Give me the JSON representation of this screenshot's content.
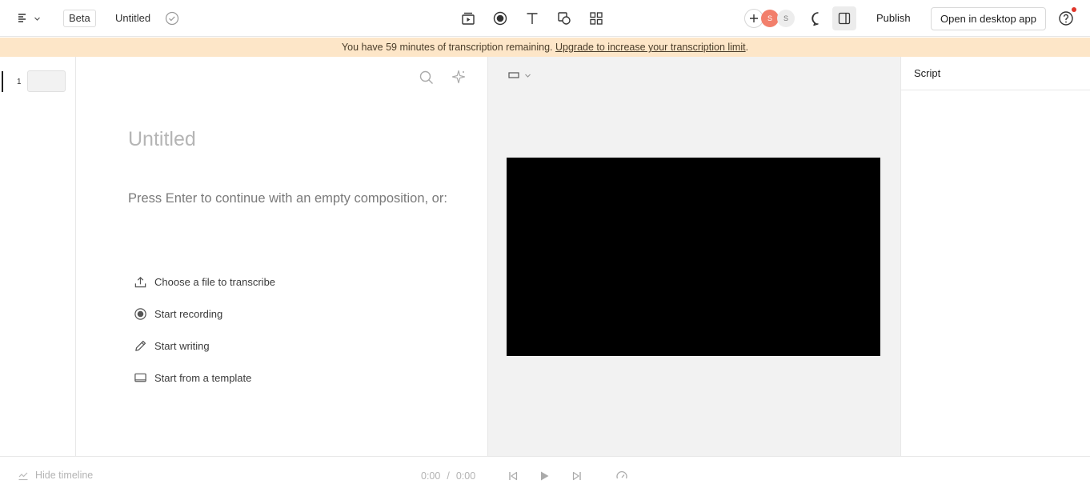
{
  "header": {
    "beta_label": "Beta",
    "document_title": "Untitled",
    "avatars": [
      "S",
      "S"
    ],
    "publish_label": "Publish",
    "desktop_button_label": "Open in desktop app"
  },
  "banner": {
    "text": "You have 59 minutes of transcription remaining. ",
    "link_text": "Upgrade to increase your transcription limit",
    "suffix": "."
  },
  "scenes": [
    {
      "number": "1"
    }
  ],
  "editor": {
    "title_placeholder": "Untitled",
    "prompt": "Press Enter to continue with an empty composition, or:",
    "options": [
      {
        "label": "Choose a file to transcribe",
        "icon": "upload-icon"
      },
      {
        "label": "Start recording",
        "icon": "record-icon"
      },
      {
        "label": "Start writing",
        "icon": "pencil-icon"
      },
      {
        "label": "Start from a template",
        "icon": "template-icon"
      }
    ]
  },
  "script_panel": {
    "title": "Script"
  },
  "playback": {
    "hide_timeline_label": "Hide timeline",
    "current_time": "0:00",
    "separator": "/",
    "total_time": "0:00"
  },
  "colors": {
    "banner_bg": "#fde6c8",
    "avatar_primary": "#f27f6b",
    "notification_dot": "#e0362b",
    "preview_bg": "#f2f2f2"
  }
}
